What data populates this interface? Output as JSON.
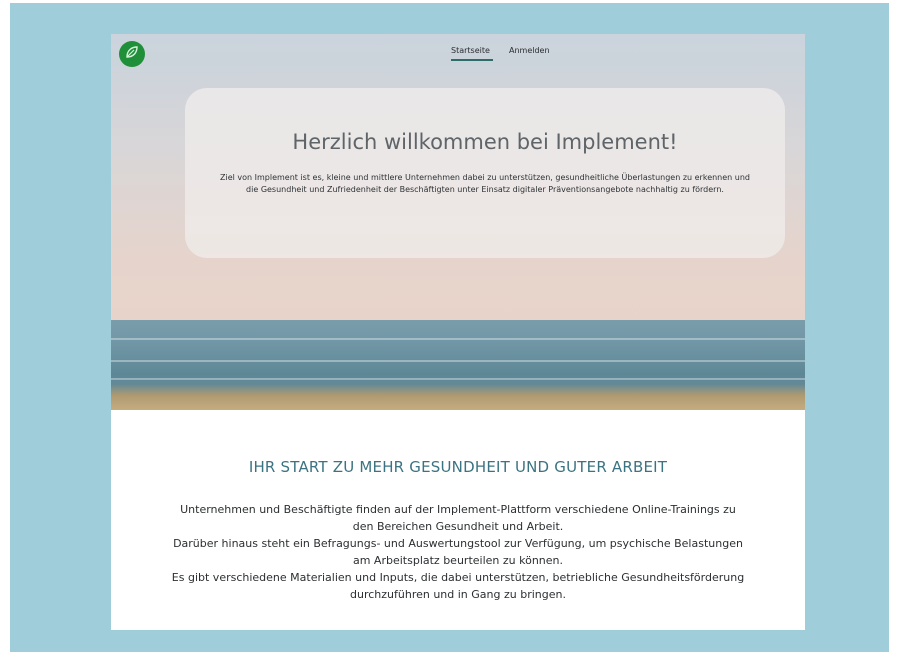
{
  "nav": {
    "items": [
      {
        "label": "Startseite",
        "active": true
      },
      {
        "label": "Anmelden",
        "active": false
      }
    ],
    "logo_icon": "leaf-icon",
    "logo_color": "#1f8f3a"
  },
  "hero": {
    "title": "Herzlich willkommen bei Implement!",
    "text": "Ziel von Implement ist es, kleine und mittlere Unternehmen dabei zu unterstützen, gesundheitliche Überlastungen zu erkennen und die Gesundheit und Zufriedenheit der Beschäftigten unter Einsatz digitaler Präventionsangebote nachhaltig zu fördern."
  },
  "section": {
    "title": "IHR START ZU MEHR GESUNDHEIT UND GUTER ARBEIT",
    "paragraphs": [
      "Unternehmen und Beschäftigte finden auf der Implement-Plattform verschiedene Online-Trainings zu den Bereichen Gesundheit und Arbeit.",
      "Darüber hinaus steht ein Befragungs- und Auswertungstool zur Verfügung, um psychische Belastungen am Arbeitsplatz beurteilen zu können.",
      "Es gibt verschiedene Materialien und Inputs, die dabei unterstützen, betriebliche Gesundheitsförderung durchzuführen und in Gang zu bringen."
    ]
  },
  "colors": {
    "frame": "#9fcdd9",
    "accent": "#3c7383",
    "nav_underline": "#2f6b68"
  }
}
